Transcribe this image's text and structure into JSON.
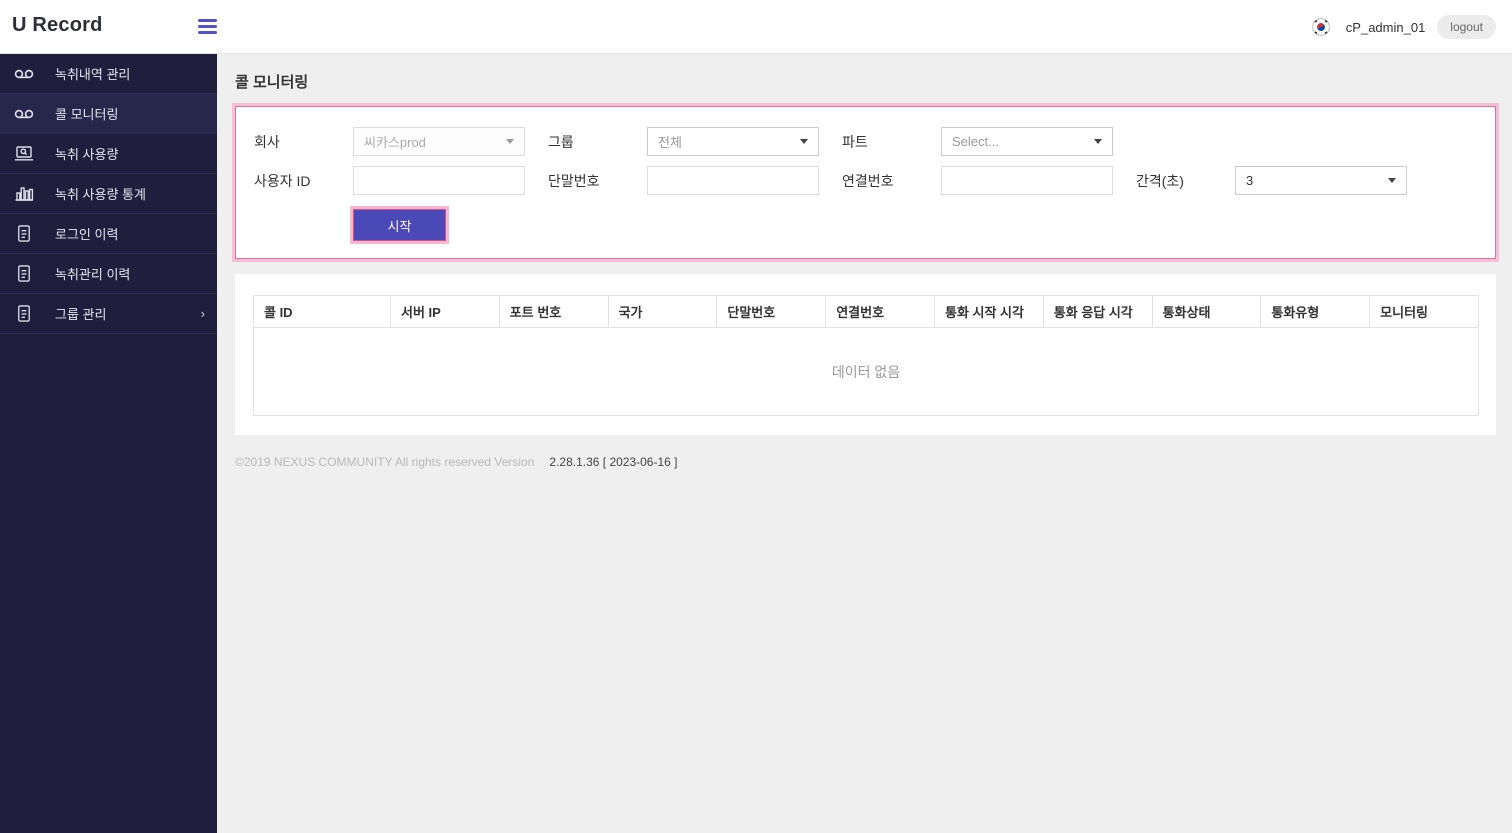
{
  "header": {
    "app_title": "U Record",
    "username": "cP_admin_01",
    "logout_label": "logout"
  },
  "sidebar": {
    "items": [
      {
        "label": "녹취내역 관리",
        "icon": "voicemail-icon",
        "active": false
      },
      {
        "label": "콜 모니터링",
        "icon": "voicemail-icon",
        "active": true
      },
      {
        "label": "녹취 사용량",
        "icon": "laptop-search-icon",
        "active": false
      },
      {
        "label": "녹취 사용량 통계",
        "icon": "bar-chart-icon",
        "active": false
      },
      {
        "label": "로그인 이력",
        "icon": "document-icon",
        "active": false
      },
      {
        "label": "녹취관리 이력",
        "icon": "document-icon",
        "active": false
      },
      {
        "label": "그룹 관리",
        "icon": "document-icon",
        "active": false,
        "chevron": "›"
      }
    ]
  },
  "page": {
    "title": "콜 모니터링"
  },
  "filter": {
    "company": {
      "label": "회사",
      "value": "씨카스prod",
      "disabled": true
    },
    "group": {
      "label": "그룹",
      "value": "전체"
    },
    "part": {
      "label": "파트",
      "value": "Select..."
    },
    "user_id": {
      "label": "사용자 ID",
      "value": ""
    },
    "terminal_no": {
      "label": "단말번호",
      "value": ""
    },
    "connection_no": {
      "label": "연결번호",
      "value": ""
    },
    "interval": {
      "label": "간격(초)",
      "value": "3"
    },
    "start_button_label": "시작"
  },
  "table": {
    "columns": [
      "콜 ID",
      "서버 IP",
      "포트 번호",
      "국가",
      "단말번호",
      "연결번호",
      "통화 시작 시각",
      "통화 응답 시각",
      "통화상태",
      "통화유형",
      "모니터링"
    ],
    "empty_text": "데이터 없음"
  },
  "footer": {
    "copyright": "©2019 NEXUS COMMUNITY All rights reserved Version",
    "version": "2.28.1.36 [ 2023-06-16 ]"
  },
  "colors": {
    "sidebar_bg": "#1f1f3d",
    "accent_purple": "#4b48b8",
    "highlight_pink": "#dd6f9f",
    "highlight_pink_glow": "#f5c0d3",
    "page_bg": "#efefef"
  }
}
